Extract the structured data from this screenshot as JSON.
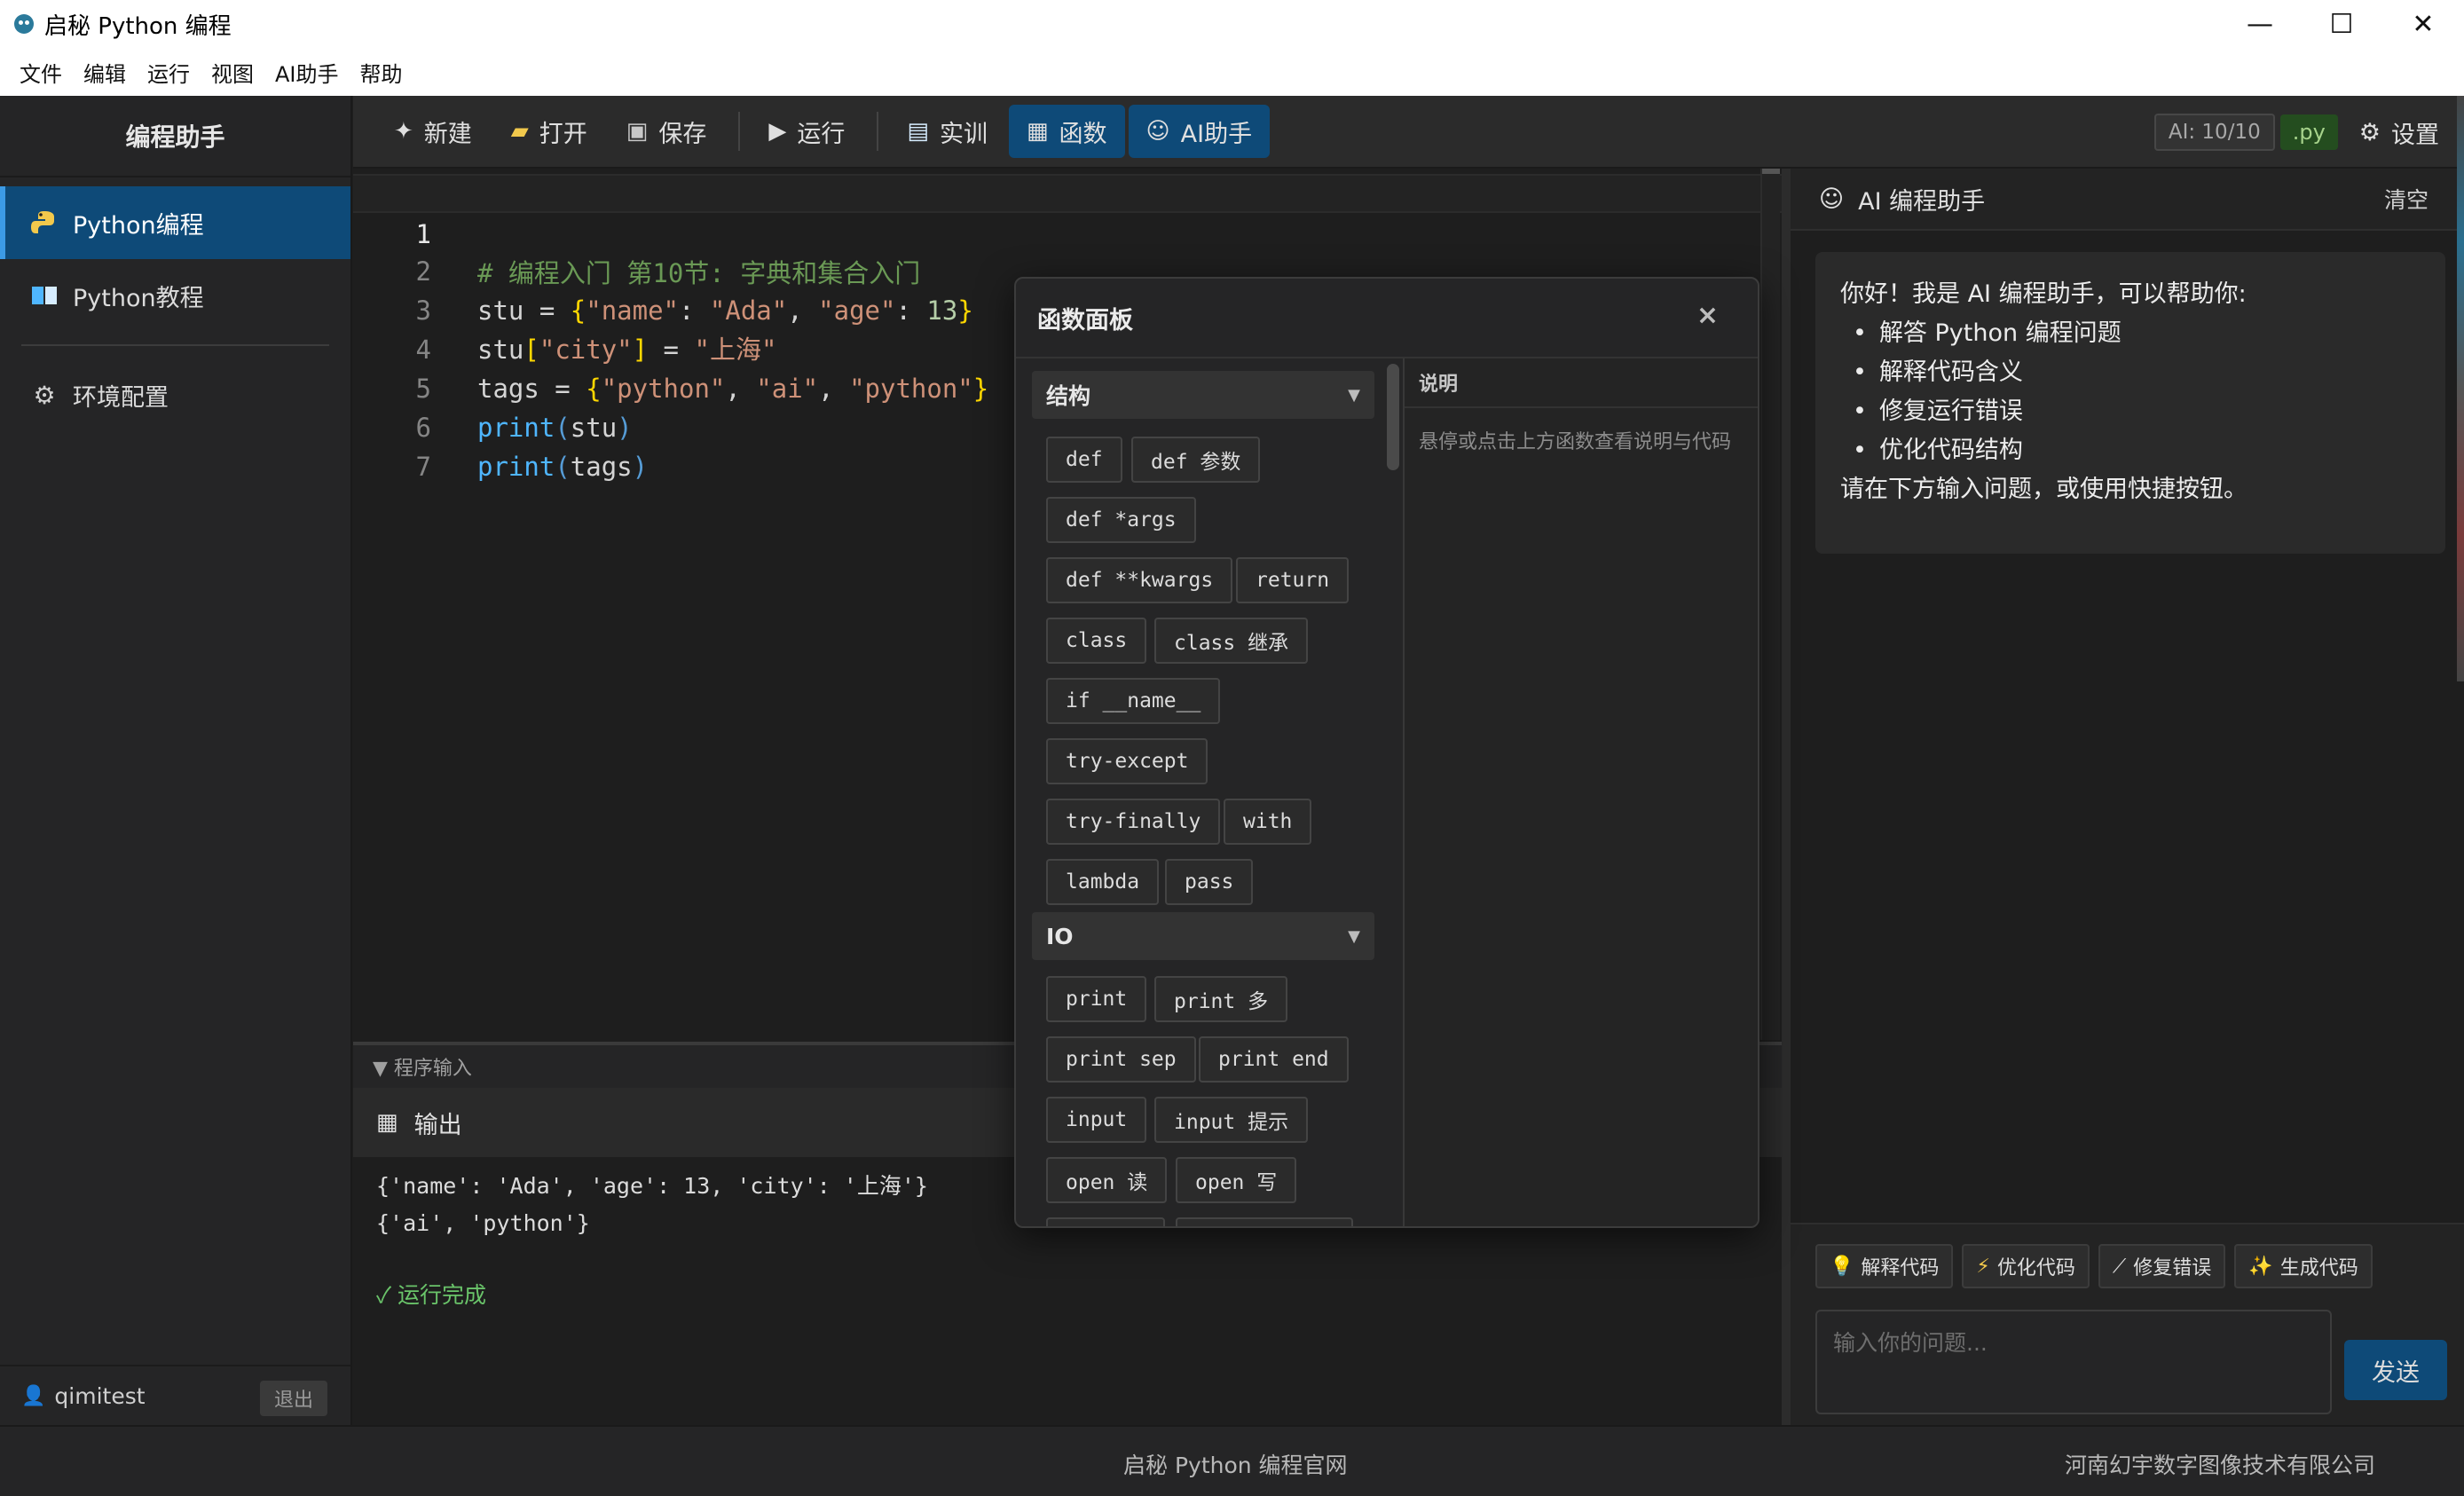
{
  "window": {
    "title": "启秘 Python 编程",
    "controls": {
      "minimize": "—",
      "maximize": "☐",
      "close": "✕"
    }
  },
  "menu": [
    "文件",
    "编辑",
    "运行",
    "视图",
    "AI助手",
    "帮助"
  ],
  "sidebar": {
    "title": "编程助手",
    "items": [
      {
        "label": "Python编程",
        "icon": "python-icon",
        "active": true
      },
      {
        "label": "Python教程",
        "icon": "book-icon",
        "active": false
      },
      {
        "label": "环境配置",
        "icon": "gear-icon",
        "active": false
      }
    ],
    "user": {
      "name": "qimitest",
      "logout": "退出"
    }
  },
  "toolbar": {
    "new": "新建",
    "open": "打开",
    "save": "保存",
    "run": "运行",
    "training": "实训",
    "functions": "函数",
    "ai": "AI助手",
    "ai_count": "AI: 10/10",
    "file_ext": ".py",
    "settings": "设置"
  },
  "editor": {
    "current_line": 1,
    "lines": [
      "# 编程入门 第10节: 字典和集合入门",
      "stu = {\"name\": \"Ada\", \"age\": 13}",
      "stu[\"city\"] = \"上海\"",
      "tags = {\"python\", \"ai\", \"python\"}",
      "print(stu)",
      "print(tags)",
      ""
    ],
    "line_numbers": [
      "1",
      "2",
      "3",
      "4",
      "5",
      "6",
      "7"
    ]
  },
  "program_input": {
    "label": "▼ 程序输入"
  },
  "output": {
    "title": "输出",
    "lines": [
      "{'name': 'Ada', 'age': 13, 'city': '上海'}",
      "{'ai', 'python'}"
    ],
    "status": "✓ 运行完成"
  },
  "function_panel": {
    "title": "函数面板",
    "close": "×",
    "description_title": "说明",
    "description_hint": "悬停或点击上方函数查看说明与代码",
    "categories": [
      {
        "name": "结构",
        "items": [
          "def",
          "def 参数",
          "def *args",
          "def **kwargs",
          "return",
          "class",
          "class 继承",
          "if __name__",
          "try-except",
          "try-finally",
          "with",
          "lambda",
          "pass"
        ]
      },
      {
        "name": "IO",
        "items": [
          "print",
          "print 多",
          "print sep",
          "print end",
          "input",
          "input 提示",
          "open 读",
          "open 写"
        ]
      }
    ]
  },
  "ai_panel": {
    "title": "AI 编程助手",
    "clear": "清空",
    "greeting": "你好！我是 AI 编程助手，可以帮助你:",
    "bullets": [
      "解答 Python 编程问题",
      "解释代码含义",
      "修复运行错误",
      "优化代码结构"
    ],
    "footer_note": "请在下方输入问题，或使用快捷按钮。",
    "quick_actions": [
      {
        "label": "解释代码",
        "icon": "lightbulb-icon"
      },
      {
        "label": "优化代码",
        "icon": "lightning-icon"
      },
      {
        "label": "修复错误",
        "icon": "wand-icon"
      },
      {
        "label": "生成代码",
        "icon": "sparkle-icon"
      }
    ],
    "input_placeholder": "输入你的问题...",
    "send": "发送"
  },
  "footer": {
    "site": "启秘 Python 编程官网",
    "company": "河南幻宇数字图像技术有限公司"
  },
  "colors": {
    "accent": "#0e4a78",
    "accent_bright": "#3c9be6",
    "comment": "#6a9955",
    "string": "#ce9178",
    "success": "#6ac46a"
  }
}
